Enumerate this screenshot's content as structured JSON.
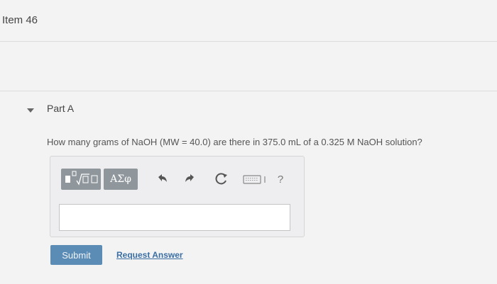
{
  "item": {
    "title": "Item 46"
  },
  "part": {
    "label": "Part A"
  },
  "question": {
    "text": "How many grams of NaOH (MW = 40.0) are there in 375.0 mL of a 0.325 M NaOH solution?"
  },
  "toolbar": {
    "greek_label": "ΑΣφ",
    "help_label": "?",
    "icons": [
      "templates-icon",
      "greek-symbols-icon",
      "undo-icon",
      "redo-icon",
      "reset-icon",
      "keyboard-icon",
      "help-icon"
    ]
  },
  "answer": {
    "value": ""
  },
  "actions": {
    "submit_label": "Submit",
    "request_label": "Request Answer"
  },
  "colors": {
    "submit": "#5b8cb5",
    "link": "#3a6ea3",
    "toolbar_button": "#8f979d"
  }
}
